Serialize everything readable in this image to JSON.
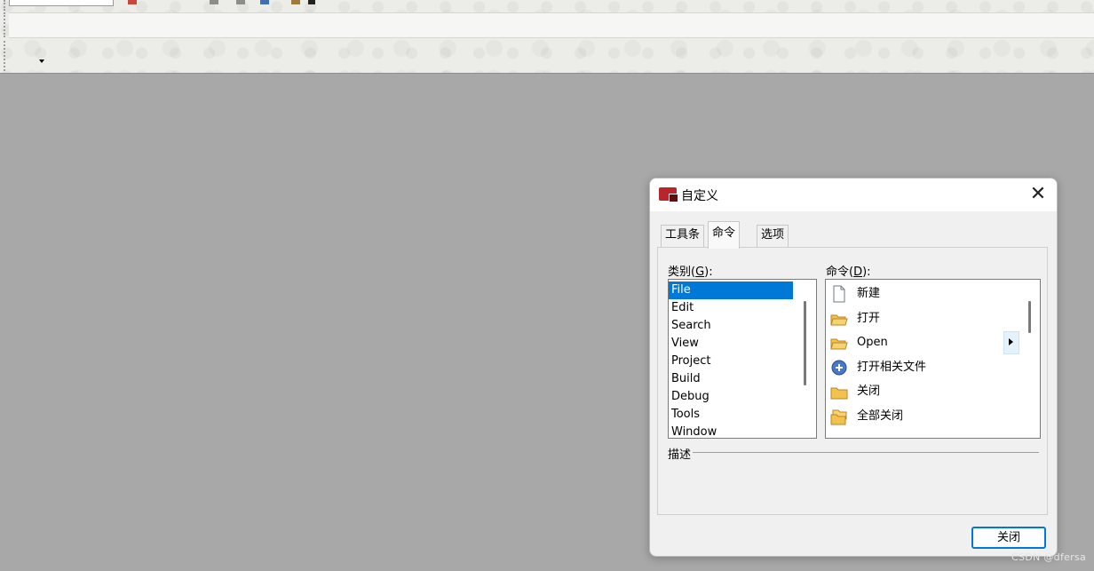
{
  "dialog": {
    "title": "自定义",
    "tabs": [
      {
        "label": "工具条",
        "active": false
      },
      {
        "label": "命令",
        "active": true
      },
      {
        "label": "选项",
        "active": false
      }
    ],
    "categories_label": "类别",
    "categories_mnemonic": "G",
    "categories": [
      "File",
      "Edit",
      "Search",
      "View",
      "Project",
      "Build",
      "Debug",
      "Tools",
      "Window"
    ],
    "selected_category": "File",
    "commands_label": "命令",
    "commands_mnemonic": "D",
    "commands": [
      {
        "label": "新建",
        "icon": "new-file-icon"
      },
      {
        "label": "打开",
        "icon": "open-folder-icon"
      },
      {
        "label": "Open",
        "icon": "open-folder-icon",
        "has_submenu": true
      },
      {
        "label": "打开相关文件",
        "icon": "open-related-file-icon"
      },
      {
        "label": "关闭",
        "icon": "close-folder-icon"
      },
      {
        "label": "全部关闭",
        "icon": "close-all-icon"
      }
    ],
    "description_label": "描述",
    "close_button": "关闭"
  },
  "watermark": "CSDN @dfersa",
  "colors": {
    "workspace": "#a8a8a8",
    "selection": "#0078d7",
    "app_icon": "#b8262b"
  }
}
